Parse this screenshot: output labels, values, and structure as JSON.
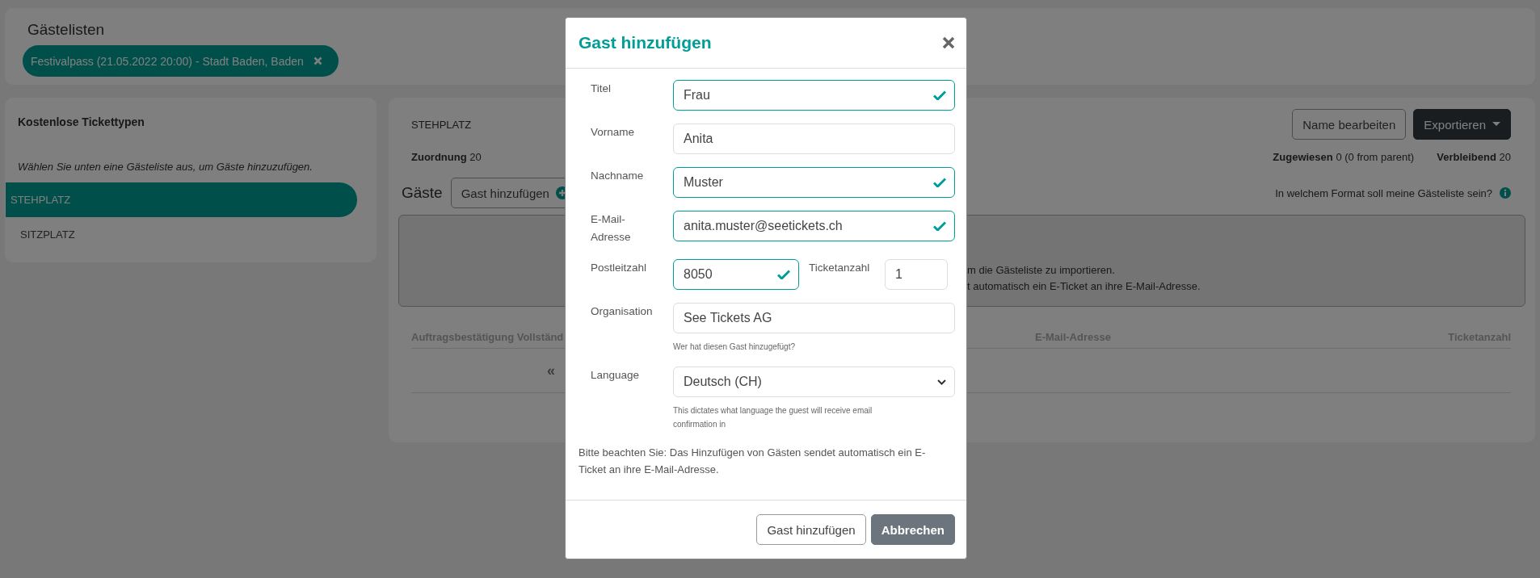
{
  "header": {
    "title": "Gästelisten",
    "filter_chip": "Festivalpass (21.05.2022 20:00) - Stadt Baden, Baden"
  },
  "sidebar": {
    "title": "Kostenlose Tickettypen",
    "hint": "Wählen Sie unten eine Gästeliste aus, um Gäste hinzuzufügen.",
    "items": [
      {
        "label": "STEHPLATZ",
        "selected": true
      },
      {
        "label": "SITZPLATZ",
        "selected": false
      }
    ]
  },
  "panel": {
    "title": "STEHPLATZ",
    "buttons": [
      {
        "label": "Name bearbeiten",
        "kind": "outline"
      },
      {
        "label": "Exportieren",
        "kind": "dropdown"
      }
    ],
    "allocation": {
      "label": "Zuordnung",
      "value": "20"
    },
    "assigned": {
      "label": "Zugewiesen",
      "value": "0 (0 from parent)"
    },
    "remaining": {
      "label": "Verbleibend",
      "value": "20"
    },
    "guests_label": "Gäste",
    "add_guest_button": "Gast hinzufügen",
    "format_question": "In welchem Format soll meine Gästeliste sein?",
    "dropzone_lines": [
      "m die Gästeliste zu importieren.",
      "t automatisch ein E-Ticket an ihre E-Mail-Adresse."
    ],
    "table": {
      "columns": [
        "Auftragsbestätigung Vollständ",
        "E-Mail-Adresse",
        "Ticketanzahl"
      ]
    },
    "pagination": "«"
  },
  "modal": {
    "title": "Gast hinzufügen",
    "rows": [
      {
        "kind": "text",
        "label": "Titel",
        "value": "Frau",
        "valid": true
      },
      {
        "kind": "text",
        "label": "Vorname",
        "value": "Anita",
        "valid": false
      },
      {
        "kind": "text",
        "label": "Nachname",
        "value": "Muster",
        "valid": true
      },
      {
        "kind": "text",
        "label": "E-Mail-Adresse",
        "value": "anita.muster@seetickets.ch",
        "valid": true
      },
      {
        "kind": "pair",
        "fields": [
          {
            "label": "Postleitzahl",
            "value": "8050",
            "valid": true
          },
          {
            "label": "Ticketanzahl",
            "value": "1",
            "valid": false
          }
        ]
      },
      {
        "kind": "text",
        "label": "Organisation",
        "value": "See Tickets AG",
        "valid": false,
        "help": "Wer hat diesen Gast hinzugefügt?"
      },
      {
        "kind": "select",
        "label": "Language",
        "value": "Deutsch (CH)",
        "help": "This dictates what language the guest will receive email confirmation in"
      }
    ],
    "note": "Bitte beachten Sie: Das Hinzufügen von Gästen sendet automatisch ein E-Ticket an ihre E-Mail-Adresse.",
    "buttons": [
      {
        "label": "Gast hinzufügen",
        "kind": "outline"
      },
      {
        "label": "Abbrechen",
        "kind": "secondary"
      }
    ]
  }
}
